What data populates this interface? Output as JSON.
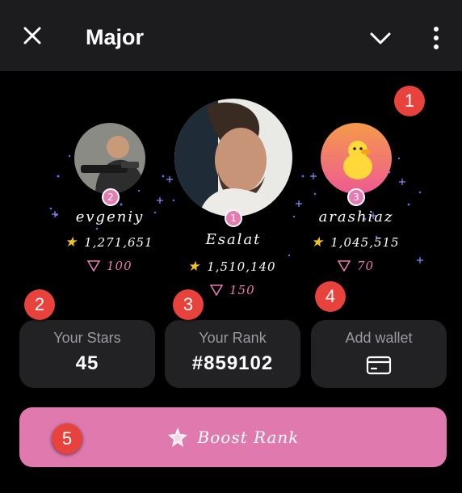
{
  "header": {
    "title": "Major"
  },
  "leaderboard": [
    {
      "rank": "1",
      "name": "Esalat",
      "stars": "1,510,140",
      "gems": "150"
    },
    {
      "rank": "2",
      "name": "evgeniy",
      "stars": "1,271,651",
      "gems": "100"
    },
    {
      "rank": "3",
      "name": "arashiaz",
      "stars": "1,045,515",
      "gems": "70"
    }
  ],
  "cards": {
    "stars": {
      "label": "Your Stars",
      "value": "45"
    },
    "rank": {
      "label": "Your Rank",
      "value": "#859102"
    },
    "wallet": {
      "label": "Add wallet"
    }
  },
  "boost": {
    "label": "Boost Rank"
  },
  "markers": [
    "1",
    "2",
    "3",
    "4",
    "5"
  ],
  "colors": {
    "accent": "#e07aae",
    "marker": "#e8423c",
    "card": "#222225",
    "header": "#1c1c1e"
  }
}
